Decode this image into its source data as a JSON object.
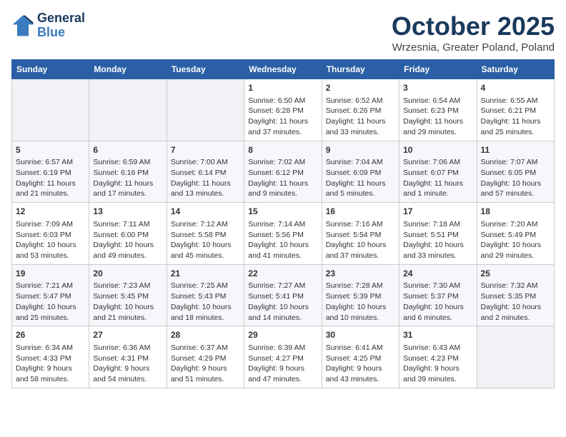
{
  "header": {
    "logo_line1": "General",
    "logo_line2": "Blue",
    "month": "October 2025",
    "location": "Wrzesnia, Greater Poland, Poland"
  },
  "days_of_week": [
    "Sunday",
    "Monday",
    "Tuesday",
    "Wednesday",
    "Thursday",
    "Friday",
    "Saturday"
  ],
  "weeks": [
    [
      {
        "day": "",
        "content": ""
      },
      {
        "day": "",
        "content": ""
      },
      {
        "day": "",
        "content": ""
      },
      {
        "day": "1",
        "content": "Sunrise: 6:50 AM\nSunset: 6:28 PM\nDaylight: 11 hours\nand 37 minutes."
      },
      {
        "day": "2",
        "content": "Sunrise: 6:52 AM\nSunset: 6:26 PM\nDaylight: 11 hours\nand 33 minutes."
      },
      {
        "day": "3",
        "content": "Sunrise: 6:54 AM\nSunset: 6:23 PM\nDaylight: 11 hours\nand 29 minutes."
      },
      {
        "day": "4",
        "content": "Sunrise: 6:55 AM\nSunset: 6:21 PM\nDaylight: 11 hours\nand 25 minutes."
      }
    ],
    [
      {
        "day": "5",
        "content": "Sunrise: 6:57 AM\nSunset: 6:19 PM\nDaylight: 11 hours\nand 21 minutes."
      },
      {
        "day": "6",
        "content": "Sunrise: 6:59 AM\nSunset: 6:16 PM\nDaylight: 11 hours\nand 17 minutes."
      },
      {
        "day": "7",
        "content": "Sunrise: 7:00 AM\nSunset: 6:14 PM\nDaylight: 11 hours\nand 13 minutes."
      },
      {
        "day": "8",
        "content": "Sunrise: 7:02 AM\nSunset: 6:12 PM\nDaylight: 11 hours\nand 9 minutes."
      },
      {
        "day": "9",
        "content": "Sunrise: 7:04 AM\nSunset: 6:09 PM\nDaylight: 11 hours\nand 5 minutes."
      },
      {
        "day": "10",
        "content": "Sunrise: 7:06 AM\nSunset: 6:07 PM\nDaylight: 11 hours\nand 1 minute."
      },
      {
        "day": "11",
        "content": "Sunrise: 7:07 AM\nSunset: 6:05 PM\nDaylight: 10 hours\nand 57 minutes."
      }
    ],
    [
      {
        "day": "12",
        "content": "Sunrise: 7:09 AM\nSunset: 6:03 PM\nDaylight: 10 hours\nand 53 minutes."
      },
      {
        "day": "13",
        "content": "Sunrise: 7:11 AM\nSunset: 6:00 PM\nDaylight: 10 hours\nand 49 minutes."
      },
      {
        "day": "14",
        "content": "Sunrise: 7:12 AM\nSunset: 5:58 PM\nDaylight: 10 hours\nand 45 minutes."
      },
      {
        "day": "15",
        "content": "Sunrise: 7:14 AM\nSunset: 5:56 PM\nDaylight: 10 hours\nand 41 minutes."
      },
      {
        "day": "16",
        "content": "Sunrise: 7:16 AM\nSunset: 5:54 PM\nDaylight: 10 hours\nand 37 minutes."
      },
      {
        "day": "17",
        "content": "Sunrise: 7:18 AM\nSunset: 5:51 PM\nDaylight: 10 hours\nand 33 minutes."
      },
      {
        "day": "18",
        "content": "Sunrise: 7:20 AM\nSunset: 5:49 PM\nDaylight: 10 hours\nand 29 minutes."
      }
    ],
    [
      {
        "day": "19",
        "content": "Sunrise: 7:21 AM\nSunset: 5:47 PM\nDaylight: 10 hours\nand 25 minutes."
      },
      {
        "day": "20",
        "content": "Sunrise: 7:23 AM\nSunset: 5:45 PM\nDaylight: 10 hours\nand 21 minutes."
      },
      {
        "day": "21",
        "content": "Sunrise: 7:25 AM\nSunset: 5:43 PM\nDaylight: 10 hours\nand 18 minutes."
      },
      {
        "day": "22",
        "content": "Sunrise: 7:27 AM\nSunset: 5:41 PM\nDaylight: 10 hours\nand 14 minutes."
      },
      {
        "day": "23",
        "content": "Sunrise: 7:28 AM\nSunset: 5:39 PM\nDaylight: 10 hours\nand 10 minutes."
      },
      {
        "day": "24",
        "content": "Sunrise: 7:30 AM\nSunset: 5:37 PM\nDaylight: 10 hours\nand 6 minutes."
      },
      {
        "day": "25",
        "content": "Sunrise: 7:32 AM\nSunset: 5:35 PM\nDaylight: 10 hours\nand 2 minutes."
      }
    ],
    [
      {
        "day": "26",
        "content": "Sunrise: 6:34 AM\nSunset: 4:33 PM\nDaylight: 9 hours\nand 58 minutes."
      },
      {
        "day": "27",
        "content": "Sunrise: 6:36 AM\nSunset: 4:31 PM\nDaylight: 9 hours\nand 54 minutes."
      },
      {
        "day": "28",
        "content": "Sunrise: 6:37 AM\nSunset: 4:29 PM\nDaylight: 9 hours\nand 51 minutes."
      },
      {
        "day": "29",
        "content": "Sunrise: 6:39 AM\nSunset: 4:27 PM\nDaylight: 9 hours\nand 47 minutes."
      },
      {
        "day": "30",
        "content": "Sunrise: 6:41 AM\nSunset: 4:25 PM\nDaylight: 9 hours\nand 43 minutes."
      },
      {
        "day": "31",
        "content": "Sunrise: 6:43 AM\nSunset: 4:23 PM\nDaylight: 9 hours\nand 39 minutes."
      },
      {
        "day": "",
        "content": ""
      }
    ]
  ]
}
